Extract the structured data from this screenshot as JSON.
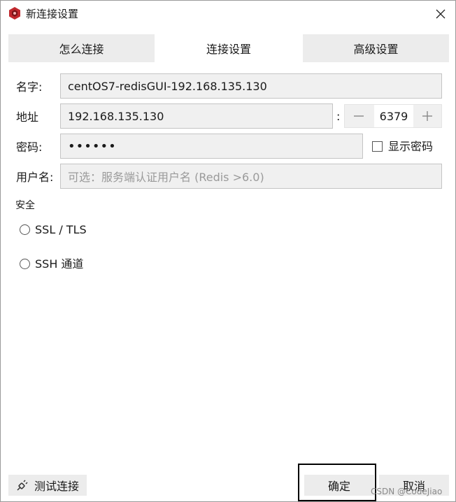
{
  "window": {
    "title": "新连接设置"
  },
  "tabs": [
    {
      "label": "怎么连接",
      "active": false
    },
    {
      "label": "连接设置",
      "active": true
    },
    {
      "label": "高级设置",
      "active": false
    }
  ],
  "form": {
    "name_label": "名字:",
    "name_value": "centOS7-redisGUI-192.168.135.130",
    "address_label": "地址",
    "address_value": "192.168.135.130",
    "port_separator": ":",
    "port_value": "6379",
    "password_label": "密码:",
    "password_value": "••••••",
    "show_password_label": "显示密码",
    "username_label": "用户名:",
    "username_placeholder": "可选：服务端认证用户名 (Redis >6.0)"
  },
  "security": {
    "title": "安全",
    "ssl_label": "SSL / TLS",
    "ssh_label": "SSH 通道"
  },
  "footer": {
    "test_label": "测试连接",
    "ok_label": "确定",
    "cancel_label": "取消",
    "watermark": "CSDN @CodeJiao"
  },
  "colors": {
    "accent": "#c0282d",
    "tab_inactive": "#ececec",
    "field_bg": "#f0f0f0"
  }
}
